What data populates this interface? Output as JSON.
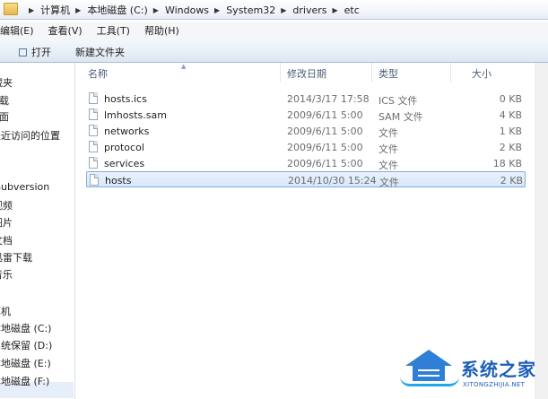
{
  "address_bar": {
    "crumbs": [
      "计算机",
      "本地磁盘 (C:)",
      "Windows",
      "System32",
      "drivers",
      "etc"
    ],
    "separator": "▶"
  },
  "menu": {
    "items": [
      "编辑(E)",
      "查看(V)",
      "工具(T)",
      "帮助(H)"
    ]
  },
  "toolbar": {
    "open_label": "打开",
    "new_folder_label": "新建文件夹"
  },
  "nav": {
    "items": [
      "藏夹",
      "载",
      "面",
      "最近访问的位置",
      "Subversion",
      "视频",
      "图片",
      "文档",
      "迅雷下载",
      "音乐",
      "算机",
      "本地磁盘 (C:)",
      "系统保留 (D:)",
      "本地磁盘 (E:)",
      "本地磁盘 (F:)"
    ],
    "selected_index": 11
  },
  "columns": {
    "name": "名称",
    "date": "修改日期",
    "type": "类型",
    "size": "大小"
  },
  "files": [
    {
      "name": "hosts.ics",
      "date": "2014/3/17 17:58",
      "type": "ICS 文件",
      "size": "0 KB"
    },
    {
      "name": "lmhosts.sam",
      "date": "2009/6/11 5:00",
      "type": "SAM 文件",
      "size": "4 KB"
    },
    {
      "name": "networks",
      "date": "2009/6/11 5:00",
      "type": "文件",
      "size": "1 KB"
    },
    {
      "name": "protocol",
      "date": "2009/6/11 5:00",
      "type": "文件",
      "size": "2 KB"
    },
    {
      "name": "services",
      "date": "2009/6/11 5:00",
      "type": "文件",
      "size": "18 KB"
    },
    {
      "name": "hosts",
      "date": "2014/10/30 15:24",
      "type": "文件",
      "size": "2 KB"
    }
  ],
  "selected_file_index": 5,
  "watermark": {
    "title": "系统之家",
    "url": "XITONGZHIJIA.NET"
  },
  "colors": {
    "selection": "#d7e7fa",
    "selection_border": "#84acdd",
    "watermark": "#1d5fb8"
  }
}
